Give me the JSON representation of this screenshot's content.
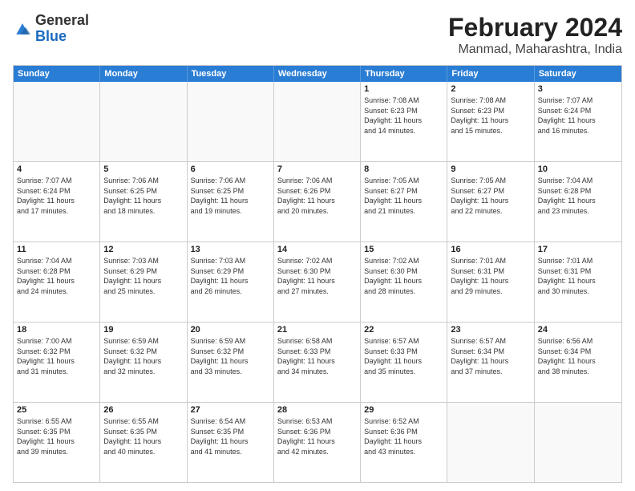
{
  "logo": {
    "general": "General",
    "blue": "Blue"
  },
  "title": "February 2024",
  "subtitle": "Manmad, Maharashtra, India",
  "header_days": [
    "Sunday",
    "Monday",
    "Tuesday",
    "Wednesday",
    "Thursday",
    "Friday",
    "Saturday"
  ],
  "rows": [
    [
      {
        "day": "",
        "info": ""
      },
      {
        "day": "",
        "info": ""
      },
      {
        "day": "",
        "info": ""
      },
      {
        "day": "",
        "info": ""
      },
      {
        "day": "1",
        "info": "Sunrise: 7:08 AM\nSunset: 6:23 PM\nDaylight: 11 hours\nand 14 minutes."
      },
      {
        "day": "2",
        "info": "Sunrise: 7:08 AM\nSunset: 6:23 PM\nDaylight: 11 hours\nand 15 minutes."
      },
      {
        "day": "3",
        "info": "Sunrise: 7:07 AM\nSunset: 6:24 PM\nDaylight: 11 hours\nand 16 minutes."
      }
    ],
    [
      {
        "day": "4",
        "info": "Sunrise: 7:07 AM\nSunset: 6:24 PM\nDaylight: 11 hours\nand 17 minutes."
      },
      {
        "day": "5",
        "info": "Sunrise: 7:06 AM\nSunset: 6:25 PM\nDaylight: 11 hours\nand 18 minutes."
      },
      {
        "day": "6",
        "info": "Sunrise: 7:06 AM\nSunset: 6:25 PM\nDaylight: 11 hours\nand 19 minutes."
      },
      {
        "day": "7",
        "info": "Sunrise: 7:06 AM\nSunset: 6:26 PM\nDaylight: 11 hours\nand 20 minutes."
      },
      {
        "day": "8",
        "info": "Sunrise: 7:05 AM\nSunset: 6:27 PM\nDaylight: 11 hours\nand 21 minutes."
      },
      {
        "day": "9",
        "info": "Sunrise: 7:05 AM\nSunset: 6:27 PM\nDaylight: 11 hours\nand 22 minutes."
      },
      {
        "day": "10",
        "info": "Sunrise: 7:04 AM\nSunset: 6:28 PM\nDaylight: 11 hours\nand 23 minutes."
      }
    ],
    [
      {
        "day": "11",
        "info": "Sunrise: 7:04 AM\nSunset: 6:28 PM\nDaylight: 11 hours\nand 24 minutes."
      },
      {
        "day": "12",
        "info": "Sunrise: 7:03 AM\nSunset: 6:29 PM\nDaylight: 11 hours\nand 25 minutes."
      },
      {
        "day": "13",
        "info": "Sunrise: 7:03 AM\nSunset: 6:29 PM\nDaylight: 11 hours\nand 26 minutes."
      },
      {
        "day": "14",
        "info": "Sunrise: 7:02 AM\nSunset: 6:30 PM\nDaylight: 11 hours\nand 27 minutes."
      },
      {
        "day": "15",
        "info": "Sunrise: 7:02 AM\nSunset: 6:30 PM\nDaylight: 11 hours\nand 28 minutes."
      },
      {
        "day": "16",
        "info": "Sunrise: 7:01 AM\nSunset: 6:31 PM\nDaylight: 11 hours\nand 29 minutes."
      },
      {
        "day": "17",
        "info": "Sunrise: 7:01 AM\nSunset: 6:31 PM\nDaylight: 11 hours\nand 30 minutes."
      }
    ],
    [
      {
        "day": "18",
        "info": "Sunrise: 7:00 AM\nSunset: 6:32 PM\nDaylight: 11 hours\nand 31 minutes."
      },
      {
        "day": "19",
        "info": "Sunrise: 6:59 AM\nSunset: 6:32 PM\nDaylight: 11 hours\nand 32 minutes."
      },
      {
        "day": "20",
        "info": "Sunrise: 6:59 AM\nSunset: 6:32 PM\nDaylight: 11 hours\nand 33 minutes."
      },
      {
        "day": "21",
        "info": "Sunrise: 6:58 AM\nSunset: 6:33 PM\nDaylight: 11 hours\nand 34 minutes."
      },
      {
        "day": "22",
        "info": "Sunrise: 6:57 AM\nSunset: 6:33 PM\nDaylight: 11 hours\nand 35 minutes."
      },
      {
        "day": "23",
        "info": "Sunrise: 6:57 AM\nSunset: 6:34 PM\nDaylight: 11 hours\nand 37 minutes."
      },
      {
        "day": "24",
        "info": "Sunrise: 6:56 AM\nSunset: 6:34 PM\nDaylight: 11 hours\nand 38 minutes."
      }
    ],
    [
      {
        "day": "25",
        "info": "Sunrise: 6:55 AM\nSunset: 6:35 PM\nDaylight: 11 hours\nand 39 minutes."
      },
      {
        "day": "26",
        "info": "Sunrise: 6:55 AM\nSunset: 6:35 PM\nDaylight: 11 hours\nand 40 minutes."
      },
      {
        "day": "27",
        "info": "Sunrise: 6:54 AM\nSunset: 6:35 PM\nDaylight: 11 hours\nand 41 minutes."
      },
      {
        "day": "28",
        "info": "Sunrise: 6:53 AM\nSunset: 6:36 PM\nDaylight: 11 hours\nand 42 minutes."
      },
      {
        "day": "29",
        "info": "Sunrise: 6:52 AM\nSunset: 6:36 PM\nDaylight: 11 hours\nand 43 minutes."
      },
      {
        "day": "",
        "info": ""
      },
      {
        "day": "",
        "info": ""
      }
    ]
  ]
}
